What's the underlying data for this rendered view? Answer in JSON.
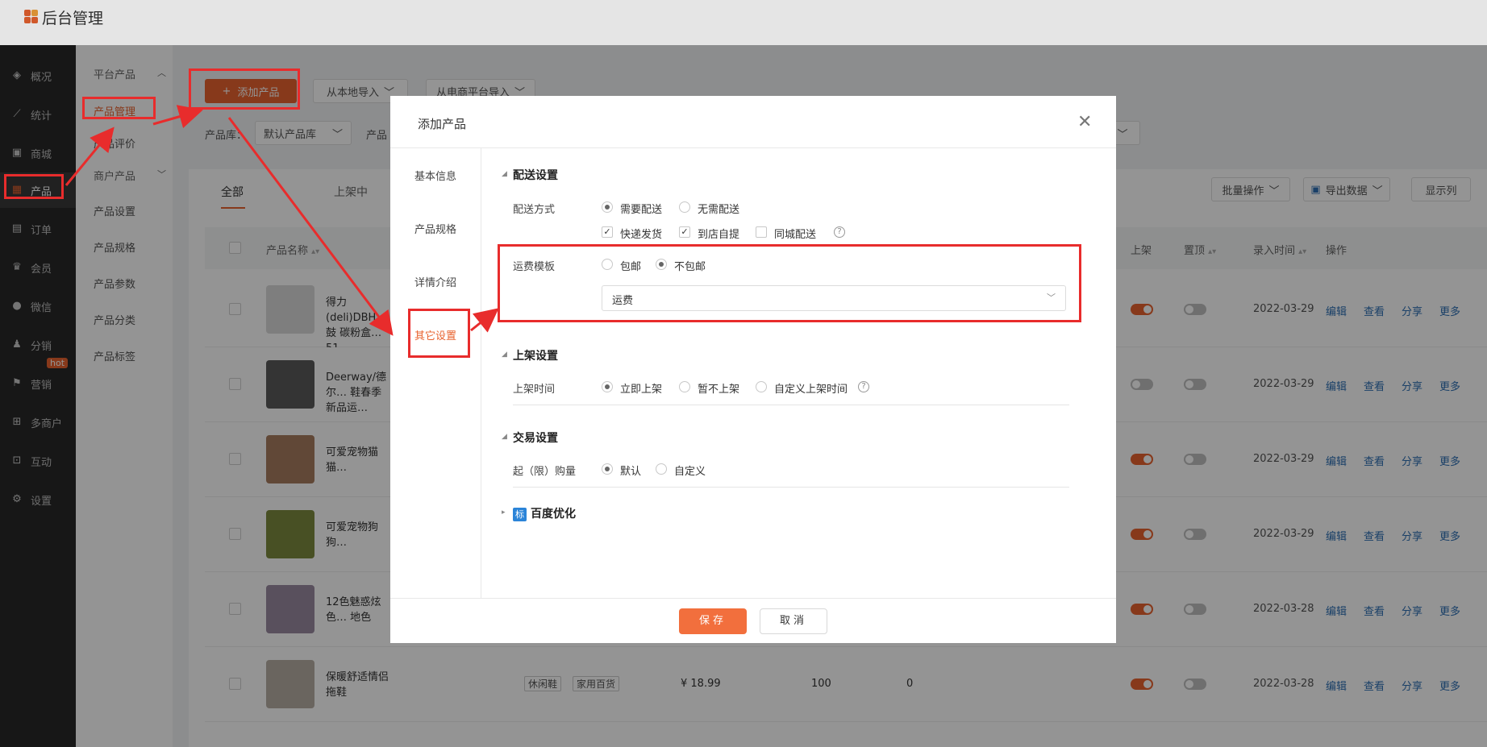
{
  "app": {
    "title": "后台管理"
  },
  "sidebar": {
    "items": [
      {
        "label": "概况",
        "icon": "layers-icon"
      },
      {
        "label": "统计",
        "icon": "chart-icon"
      },
      {
        "label": "商城",
        "icon": "store-icon"
      },
      {
        "label": "产品",
        "icon": "grid-icon"
      },
      {
        "label": "订单",
        "icon": "order-icon"
      },
      {
        "label": "会员",
        "icon": "crown-icon"
      },
      {
        "label": "微信",
        "icon": "wechat-icon"
      },
      {
        "label": "分销",
        "icon": "distribution-icon"
      },
      {
        "label": "营销",
        "icon": "flag-icon"
      },
      {
        "label": "多商户",
        "icon": "merchant-icon"
      },
      {
        "label": "互动",
        "icon": "interact-icon"
      },
      {
        "label": "设置",
        "icon": "gear-icon"
      }
    ],
    "hot_badge": "hot"
  },
  "subnav": {
    "group1": "平台产品",
    "items1": [
      "产品管理",
      "产品评价"
    ],
    "group2": "商户产品",
    "items2": [
      "产品设置",
      "产品规格",
      "产品参数",
      "产品分类",
      "产品标签"
    ]
  },
  "toolbar": {
    "add": "添加产品",
    "import_local": "从本地导入",
    "import_platform": "从电商平台导入",
    "library_label": "产品库：",
    "library_value": "默认产品库",
    "category_label": "产品"
  },
  "tabs": [
    "全部",
    "上架中"
  ],
  "actions": {
    "batch": "批量操作",
    "export": "导出数据",
    "columns": "显示列"
  },
  "table": {
    "headers": {
      "name": "产品名称",
      "shelf": "上架",
      "top": "置顶",
      "time": "录入时间",
      "ops": "操作"
    },
    "ops": [
      "编辑",
      "查看",
      "分享",
      "更多"
    ],
    "rows": [
      {
        "name": "得力(deli)DBH… 鼓 碳粉盒…51…",
        "date": "2022-03-29",
        "shelf": true,
        "top": false
      },
      {
        "name": "Deerway/德尔… 鞋春季新品运…",
        "date": "2022-03-29",
        "shelf": false,
        "top": false
      },
      {
        "name": "可爱宠物猫猫…",
        "date": "2022-03-29",
        "shelf": true,
        "top": false
      },
      {
        "name": "可爱宠物狗狗…",
        "date": "2022-03-29",
        "shelf": true,
        "top": false
      },
      {
        "name": "12色魅惑炫色… 地色",
        "date": "2022-03-28",
        "shelf": true,
        "top": false
      },
      {
        "name": "保暖舒适情侣拖鞋",
        "date": "2022-03-28",
        "shelf": true,
        "top": false,
        "tags": [
          "休闲鞋",
          "家用百货"
        ],
        "price": "¥ 18.99",
        "stock": "100",
        "sales": "0"
      }
    ]
  },
  "modal": {
    "title": "添加产品",
    "tabs": [
      "基本信息",
      "产品规格",
      "详情介绍",
      "其它设置"
    ],
    "delivery": {
      "section": "配送设置",
      "method_label": "配送方式",
      "method_options": [
        "需要配送",
        "无需配送"
      ],
      "checks": [
        "快递发货",
        "到店自提",
        "同城配送"
      ],
      "freight_label": "运费模板",
      "freight_options": [
        "包邮",
        "不包邮"
      ],
      "freight_select": "运费"
    },
    "shelf": {
      "section": "上架设置",
      "label": "上架时间",
      "options": [
        "立即上架",
        "暂不上架",
        "自定义上架时间"
      ]
    },
    "trade": {
      "section": "交易设置",
      "label": "起（限）购量",
      "options": [
        "默认",
        "自定义"
      ]
    },
    "seo": {
      "section": "百度优化",
      "badge": "标"
    },
    "save": "保存",
    "cancel": "取消"
  },
  "colors": {
    "accent": "#e8632f",
    "annotation": "#e82c2c",
    "link": "#2d6fb3"
  }
}
